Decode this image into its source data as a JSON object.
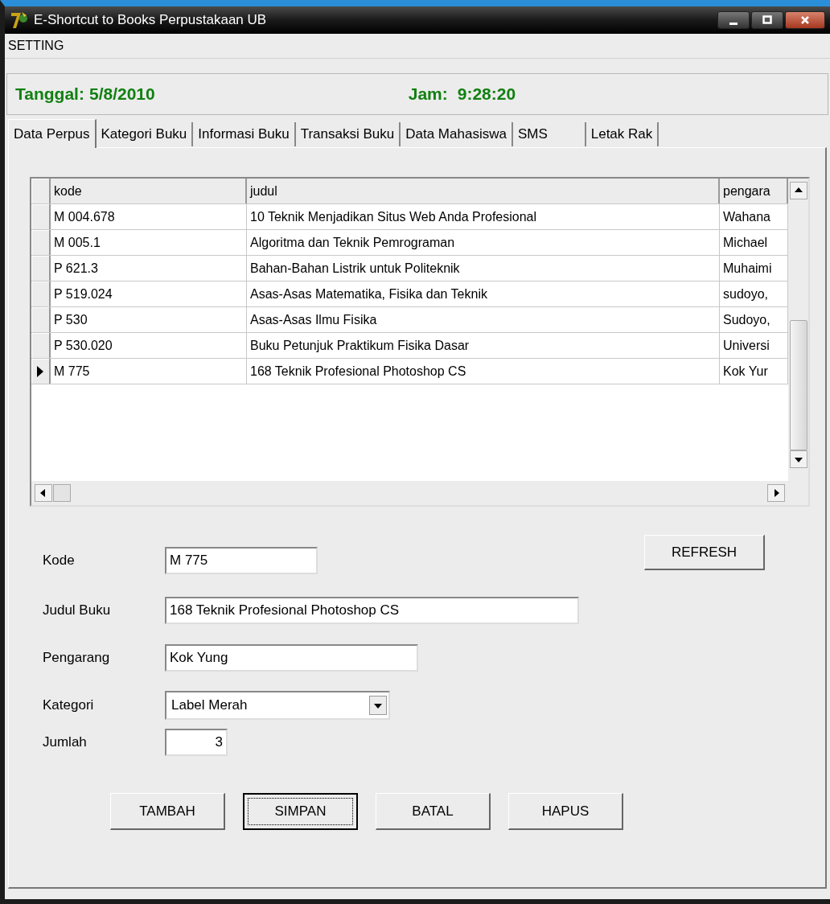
{
  "window": {
    "title": "E-Shortcut to Books Perpustakaan UB"
  },
  "menu": [
    "SETTING"
  ],
  "header": {
    "date_label": "Tanggal:",
    "date": "5/8/2010",
    "time_label": "Jam:",
    "time": "9:28:20"
  },
  "tabs": [
    {
      "label": "Data Perpus",
      "selected": true
    },
    {
      "label": "Kategori Buku",
      "selected": false
    },
    {
      "label": "Informasi Buku",
      "selected": false
    },
    {
      "label": "Transaksi Buku",
      "selected": false
    },
    {
      "label": "Data Mahasiswa",
      "selected": false
    },
    {
      "label": "SMS",
      "selected": false
    },
    {
      "label": "Letak Rak",
      "selected": false
    }
  ],
  "table": {
    "columns": [
      "kode",
      "judul",
      "pengara"
    ],
    "rows": [
      {
        "cells": [
          "M 004.678",
          "10 Teknik Menjadikan Situs  Web  Anda  Profesional",
          "Wahana"
        ],
        "selected": false
      },
      {
        "cells": [
          "M 005.1",
          "Algoritma dan Teknik Pemrograman",
          "Michael"
        ],
        "selected": false
      },
      {
        "cells": [
          "P 621.3",
          "Bahan-Bahan Listrik untuk Politeknik",
          "Muhaimi"
        ],
        "selected": false
      },
      {
        "cells": [
          "P 519.024",
          "Asas-Asas Matematika, Fisika dan Teknik",
          "sudoyo,"
        ],
        "selected": false
      },
      {
        "cells": [
          "P 530",
          "Asas-Asas Ilmu Fisika",
          "Sudoyo,"
        ],
        "selected": false
      },
      {
        "cells": [
          "P 530.020",
          "Buku Petunjuk Praktikum Fisika Dasar",
          "Universi"
        ],
        "selected": false
      },
      {
        "cells": [
          "M 775",
          "168 Teknik Profesional Photoshop CS",
          "Kok Yur"
        ],
        "selected": true
      }
    ]
  },
  "form": {
    "fields": [
      {
        "label": "Kode",
        "value": "M 775",
        "kind": "text"
      },
      {
        "label": "Judul Buku",
        "value": "168 Teknik Profesional Photoshop CS",
        "kind": "text"
      },
      {
        "label": "Pengarang",
        "value": "Kok Yung",
        "kind": "text"
      },
      {
        "label": "Kategori",
        "value": "Label Merah",
        "kind": "dropdown"
      },
      {
        "label": "Jumlah",
        "value": "3",
        "kind": "number"
      }
    ],
    "refresh_button": "REFRESH",
    "buttons": [
      {
        "label": "TAMBAH",
        "focused": false
      },
      {
        "label": "SIMPAN",
        "focused": true
      },
      {
        "label": "BATAL",
        "focused": false
      },
      {
        "label": "HAPUS",
        "focused": false
      }
    ]
  }
}
